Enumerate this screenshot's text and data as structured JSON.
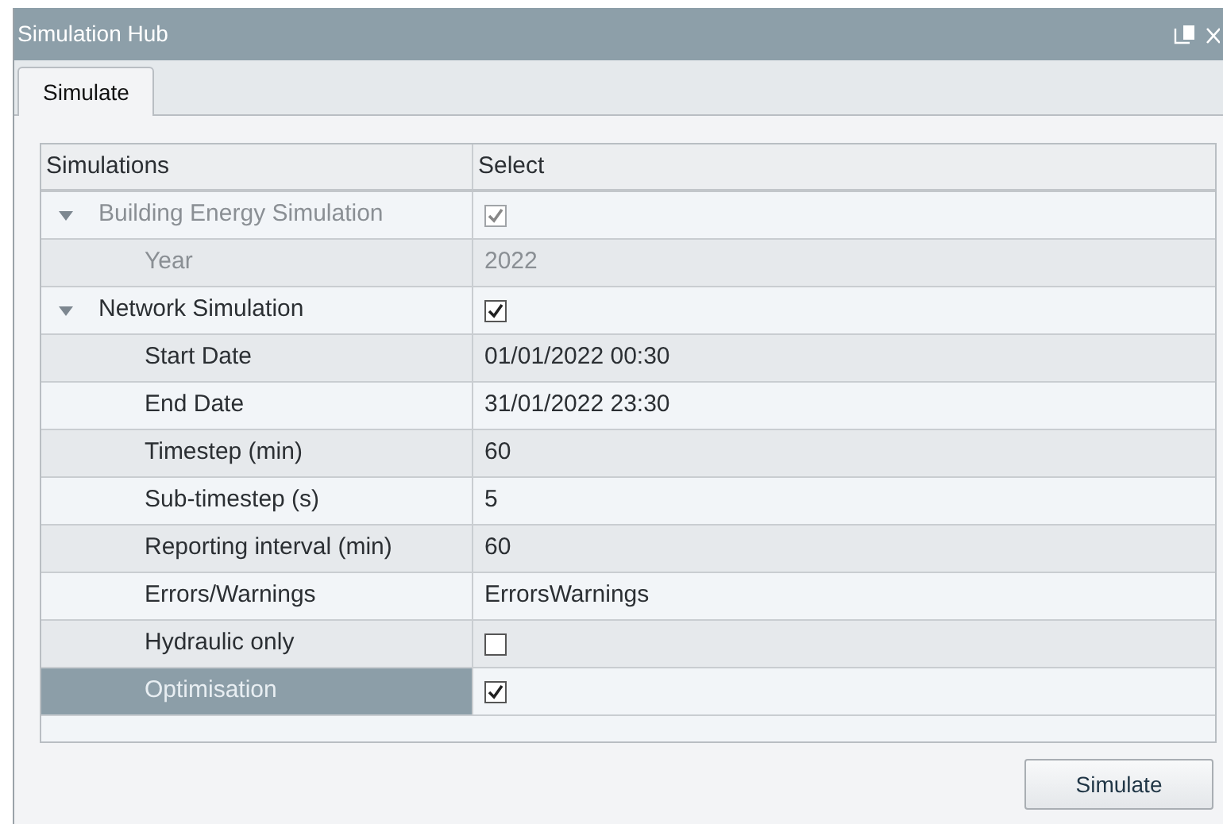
{
  "window": {
    "title": "Simulation Hub"
  },
  "tabs": [
    {
      "label": "Simulate",
      "selected": true
    }
  ],
  "table": {
    "columns": [
      "Simulations",
      "Select"
    ],
    "rows": [
      {
        "label": "Building Energy Simulation",
        "expanded": true,
        "disabled": true,
        "selected": false,
        "value": {
          "kind": "checkbox",
          "checked": true
        },
        "children": [
          {
            "label": "Year",
            "disabled": true,
            "selected": false,
            "value": {
              "kind": "text",
              "text": "2022"
            }
          }
        ]
      },
      {
        "label": "Network Simulation",
        "expanded": true,
        "disabled": false,
        "selected": false,
        "value": {
          "kind": "checkbox",
          "checked": true
        },
        "children": [
          {
            "label": "Start Date",
            "disabled": false,
            "selected": false,
            "value": {
              "kind": "text",
              "text": "01/01/2022 00:30"
            }
          },
          {
            "label": "End Date",
            "disabled": false,
            "selected": false,
            "value": {
              "kind": "text",
              "text": "31/01/2022 23:30"
            }
          },
          {
            "label": "Timestep (min)",
            "disabled": false,
            "selected": false,
            "value": {
              "kind": "text",
              "text": "60"
            }
          },
          {
            "label": "Sub-timestep (s)",
            "disabled": false,
            "selected": false,
            "value": {
              "kind": "text",
              "text": "5"
            }
          },
          {
            "label": "Reporting interval (min)",
            "disabled": false,
            "selected": false,
            "value": {
              "kind": "text",
              "text": "60"
            }
          },
          {
            "label": "Errors/Warnings",
            "disabled": false,
            "selected": false,
            "value": {
              "kind": "text",
              "text": "ErrorsWarnings"
            }
          },
          {
            "label": "Hydraulic only",
            "disabled": false,
            "selected": false,
            "value": {
              "kind": "checkbox",
              "checked": false
            }
          },
          {
            "label": "Optimisation",
            "disabled": false,
            "selected": true,
            "value": {
              "kind": "checkbox",
              "checked": true
            }
          }
        ]
      }
    ]
  },
  "buttons": [
    {
      "label": "Simulate"
    }
  ]
}
